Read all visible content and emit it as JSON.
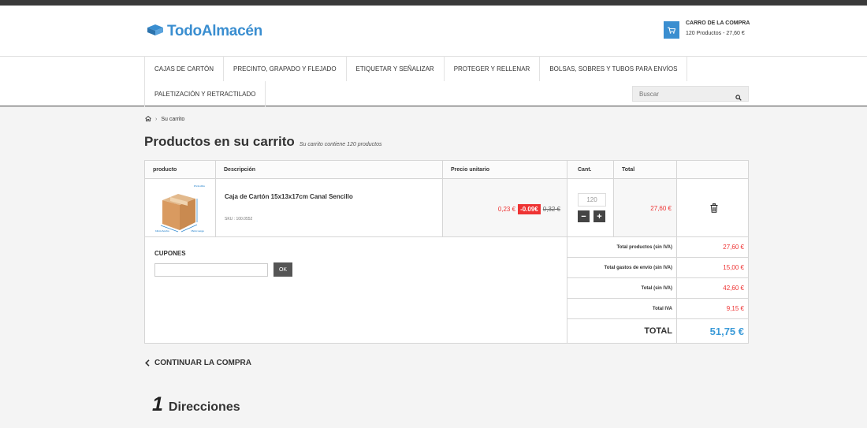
{
  "header": {
    "logo_text": "TodoAlmacén",
    "cart": {
      "title": "CARRO DE LA COMPRA",
      "summary": "120 Productos - 27,60 €"
    }
  },
  "nav": {
    "row1": [
      "CAJAS DE CARTÓN",
      "PRECINTO, GRAPADO Y FLEJADO",
      "ETIQUETAR Y SEÑALIZAR",
      "PROTEGER Y RELLENAR",
      "BOLSAS, SOBRES Y TUBOS PARA ENVÍOS"
    ],
    "row2": [
      "PALETIZACIÓN Y RETRACTILADO"
    ],
    "search_placeholder": "Buscar"
  },
  "breadcrumb": {
    "current": "Su carrito"
  },
  "page": {
    "title": "Productos en su carrito",
    "subtitle": "Su carrito contiene 120 productos"
  },
  "table": {
    "headers": {
      "product": "producto",
      "description": "Descripción",
      "unit_price": "Precio unitario",
      "qty": "Cant.",
      "total": "Total"
    },
    "item": {
      "name": "Caja de Cartón 15x13x17cm Canal Sencillo",
      "sku": "SKU : 100.0552",
      "price": "0,23 €",
      "discount": "-0.09€",
      "old_price": "0,32 €",
      "qty": "120",
      "total": "27,60 €",
      "image_labels": {
        "top": "17cm Alto",
        "bottom_left": "13cm Ancho",
        "bottom_right": "15cm Largo"
      }
    }
  },
  "coupons": {
    "title": "CUPONES",
    "button": "OK"
  },
  "summary": {
    "rows": [
      {
        "label": "Total productos (sin IVA)",
        "value": "27,60 €"
      },
      {
        "label": "Total gastos de envío (sin IVA)",
        "value": "15,00 €"
      },
      {
        "label": "Total (sin IVA)",
        "value": "42,60 €"
      },
      {
        "label": "Total IVA",
        "value": "9,15 €"
      }
    ],
    "total_label": "TOTAL",
    "total_value": "51,75 €"
  },
  "continue_label": "CONTINUAR LA COMPRA",
  "step": {
    "number": "1",
    "title": "Direcciones"
  },
  "colors": {
    "brand_blue": "#3a8ed0",
    "price_red": "#e33333",
    "total_blue": "#3a9ad8"
  }
}
